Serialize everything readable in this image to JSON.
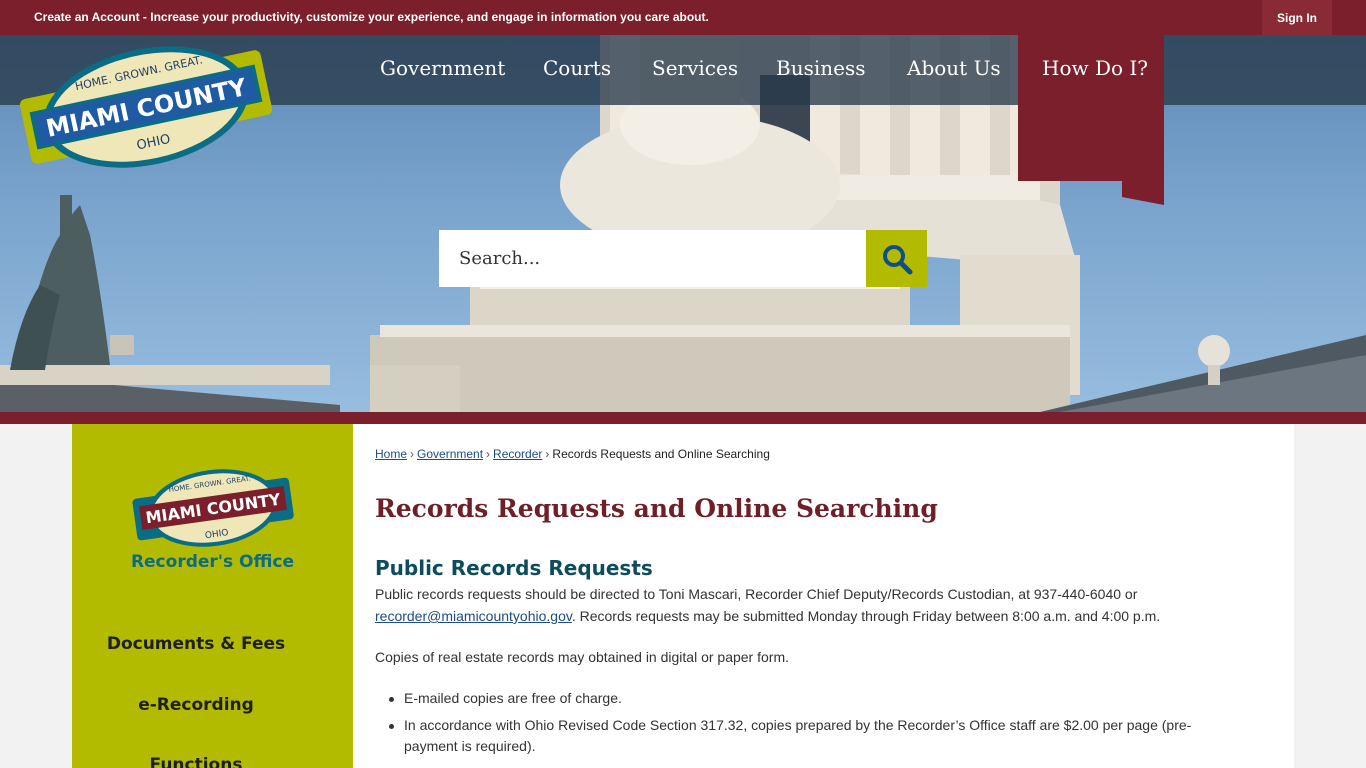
{
  "topbar": {
    "promo_link": "Create an Account",
    "promo_text": " - Increase your productivity, customize your experience, and engage in information you care about.",
    "signin": "Sign In"
  },
  "logo": {
    "tagline": "HOME. GROWN. GREAT.",
    "name": "MIAMI COUNTY",
    "state": "OHIO"
  },
  "nav": {
    "items": [
      "Government",
      "Courts",
      "Services",
      "Business",
      "About Us"
    ],
    "how_do_i": "How Do I?"
  },
  "search": {
    "placeholder": "Search..."
  },
  "sidebar": {
    "dept": "Recorder's Office",
    "items": [
      "Documents & Fees",
      "e-Recording",
      "Functions"
    ]
  },
  "breadcrumb": {
    "home": "Home",
    "government": "Government",
    "recorder": "Recorder",
    "current": "Records Requests and Online Searching"
  },
  "page": {
    "title": "Records Requests and Online Searching",
    "section_title": "Public Records Requests",
    "para1_a": "Public records requests should be directed to Toni Mascari, Recorder Chief Deputy/Records Custodian, at 937-440-6040 or",
    "para1_email": "recorder@miamicountyohio.gov",
    "para1_b": ".  Records requests may be submitted Monday through Friday between 8:00 a.m. and 4:00 p.m.",
    "para2": "Copies of real estate records may obtained in digital or paper form.",
    "bullets": [
      "E-mailed copies are free of charge.",
      " In accordance with Ohio Revised Code Section 317.32, copies prepared by the Recorder’s Office staff are $2.00 per page (pre-payment is required)."
    ]
  },
  "colors": {
    "maroon": "#7a1f2b",
    "lime": "#b3bb00",
    "teal": "#0d4d5b"
  }
}
